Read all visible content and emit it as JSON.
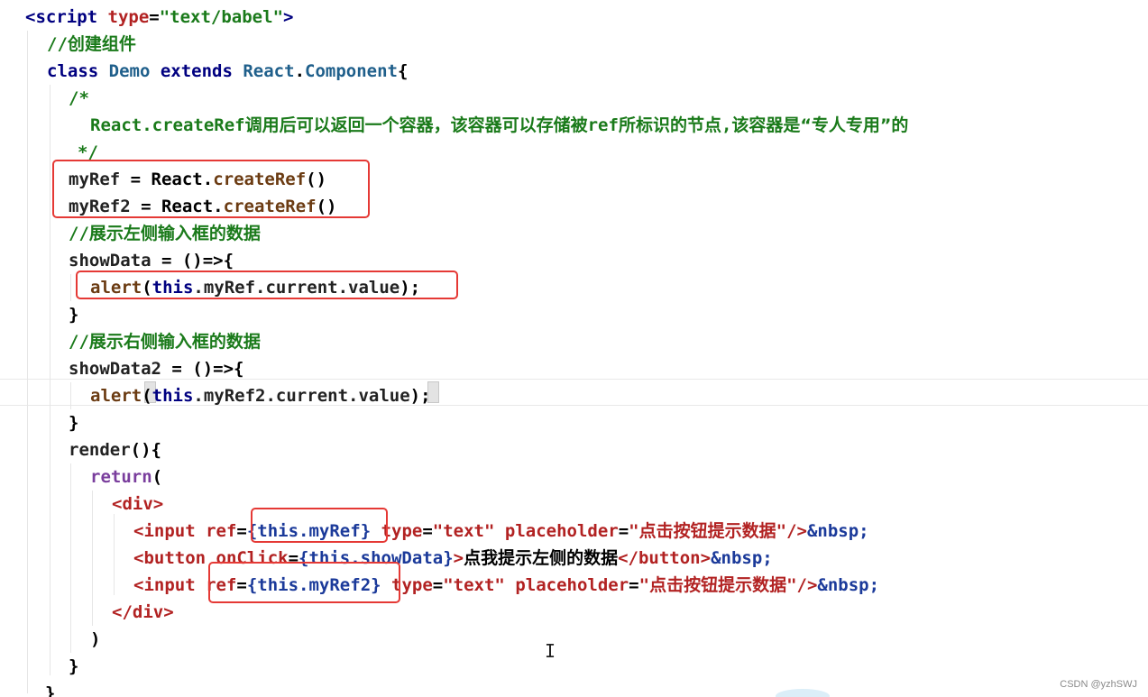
{
  "lines": [
    [
      {
        "t": "<script ",
        "c": "tag"
      },
      {
        "t": "type",
        "c": "attr"
      },
      {
        "t": "=",
        "c": "punct"
      },
      {
        "t": "\"text/babel\"",
        "c": "string"
      },
      {
        "t": ">",
        "c": "tag"
      }
    ],
    [
      {
        "t": "//",
        "c": "comment"
      },
      {
        "t": "创建组件",
        "c": "comment-cn"
      }
    ],
    [
      {
        "t": "class ",
        "c": "keyword"
      },
      {
        "t": "Demo ",
        "c": "class"
      },
      {
        "t": "extends ",
        "c": "keyword"
      },
      {
        "t": "React",
        "c": "class"
      },
      {
        "t": ".",
        "c": "punct"
      },
      {
        "t": "Component",
        "c": "class"
      },
      {
        "t": "{",
        "c": "punct"
      }
    ],
    [
      {
        "t": "/*",
        "c": "comment"
      }
    ],
    [
      {
        "t": "React.createRef",
        "c": "comment"
      },
      {
        "t": "调用后可以返回一个容器，该容器可以存储被",
        "c": "comment-cn"
      },
      {
        "t": "ref",
        "c": "comment"
      },
      {
        "t": "所标识的节点",
        "c": "comment-cn"
      },
      {
        "t": ",",
        "c": "comment"
      },
      {
        "t": "该容器是“专人专用”的",
        "c": "comment-cn"
      }
    ],
    [
      {
        "t": "*/",
        "c": "comment"
      }
    ],
    [
      {
        "t": "myRef",
        "c": "prop"
      },
      {
        "t": " = ",
        "c": "punct"
      },
      {
        "t": "React",
        "c": "plain"
      },
      {
        "t": ".",
        "c": "punct"
      },
      {
        "t": "createRef",
        "c": "method"
      },
      {
        "t": "()",
        "c": "punct"
      }
    ],
    [
      {
        "t": "myRef2",
        "c": "prop"
      },
      {
        "t": " = ",
        "c": "punct"
      },
      {
        "t": "React",
        "c": "plain"
      },
      {
        "t": ".",
        "c": "punct"
      },
      {
        "t": "createRef",
        "c": "method"
      },
      {
        "t": "()",
        "c": "punct"
      }
    ],
    [
      {
        "t": "//",
        "c": "comment"
      },
      {
        "t": "展示左侧输入框的数据",
        "c": "comment-cn"
      }
    ],
    [
      {
        "t": "showData",
        "c": "prop"
      },
      {
        "t": " = ",
        "c": "punct"
      },
      {
        "t": "()=>{",
        "c": "punct"
      }
    ],
    [
      {
        "t": "alert",
        "c": "method"
      },
      {
        "t": "(",
        "c": "punct"
      },
      {
        "t": "this",
        "c": "keyword"
      },
      {
        "t": ".myRef.current.value",
        "c": "prop"
      },
      {
        "t": ");",
        "c": "punct"
      }
    ],
    [
      {
        "t": "}",
        "c": "punct"
      }
    ],
    [
      {
        "t": "//",
        "c": "comment"
      },
      {
        "t": "展示右侧输入框的数据",
        "c": "comment-cn"
      }
    ],
    [
      {
        "t": "showData2",
        "c": "prop"
      },
      {
        "t": " = ",
        "c": "punct"
      },
      {
        "t": "()=>{",
        "c": "punct"
      }
    ],
    [
      {
        "t": "alert",
        "c": "method"
      },
      {
        "t": "(",
        "c": "punct"
      },
      {
        "t": "this",
        "c": "keyword"
      },
      {
        "t": ".myRef2.current.value",
        "c": "prop"
      },
      {
        "t": ")",
        "c": "punct"
      },
      {
        "t": ";",
        "c": "punct"
      }
    ],
    [
      {
        "t": "}",
        "c": "punct"
      }
    ],
    [
      {
        "t": "render",
        "c": "prop"
      },
      {
        "t": "(){",
        "c": "punct"
      }
    ],
    [
      {
        "t": "return",
        "c": "func"
      },
      {
        "t": "(",
        "c": "punct"
      }
    ],
    [
      {
        "t": "<div>",
        "c": "attr"
      }
    ],
    [
      {
        "t": "<input ",
        "c": "attr"
      },
      {
        "t": "ref",
        "c": "attr"
      },
      {
        "t": "=",
        "c": "punct"
      },
      {
        "t": "{this.myRef}",
        "c": "jsx"
      },
      {
        "t": " type",
        "c": "attr"
      },
      {
        "t": "=",
        "c": "punct"
      },
      {
        "t": "\"text\"",
        "c": "attr"
      },
      {
        "t": " placeholder",
        "c": "attr"
      },
      {
        "t": "=",
        "c": "punct"
      },
      {
        "t": "\"",
        "c": "attr"
      },
      {
        "t": "点击按钮提示数据",
        "c": "attr-cn"
      },
      {
        "t": "\"/>",
        "c": "attr"
      },
      {
        "t": "&nbsp;",
        "c": "jsx"
      }
    ],
    [
      {
        "t": "<button ",
        "c": "attr"
      },
      {
        "t": "onClick",
        "c": "attr"
      },
      {
        "t": "=",
        "c": "punct"
      },
      {
        "t": "{this.showData}",
        "c": "jsx"
      },
      {
        "t": ">",
        "c": "attr"
      },
      {
        "t": "点我提示左侧的数据",
        "c": "plain-cn"
      },
      {
        "t": "</button>",
        "c": "attr"
      },
      {
        "t": "&nbsp;",
        "c": "jsx"
      }
    ],
    [
      {
        "t": "<input ",
        "c": "attr"
      },
      {
        "t": "ref",
        "c": "attr"
      },
      {
        "t": "=",
        "c": "punct"
      },
      {
        "t": "{this.myRef2}",
        "c": "jsx"
      },
      {
        "t": " type",
        "c": "attr"
      },
      {
        "t": "=",
        "c": "punct"
      },
      {
        "t": "\"text\"",
        "c": "attr"
      },
      {
        "t": " placeholder",
        "c": "attr"
      },
      {
        "t": "=",
        "c": "punct"
      },
      {
        "t": "\"",
        "c": "attr"
      },
      {
        "t": "点击按钮提示数据",
        "c": "attr-cn"
      },
      {
        "t": "\"/>",
        "c": "attr"
      },
      {
        "t": "&nbsp;",
        "c": "jsx"
      }
    ],
    [
      {
        "t": "</div>",
        "c": "attr"
      }
    ],
    [
      {
        "t": ")",
        "c": "punct"
      }
    ],
    [
      {
        "t": "}",
        "c": "punct"
      }
    ],
    [
      {
        "t": "}",
        "c": "punct"
      }
    ]
  ],
  "watermark": "CSDN @yzhSWJ",
  "cursor_glyph": "I"
}
